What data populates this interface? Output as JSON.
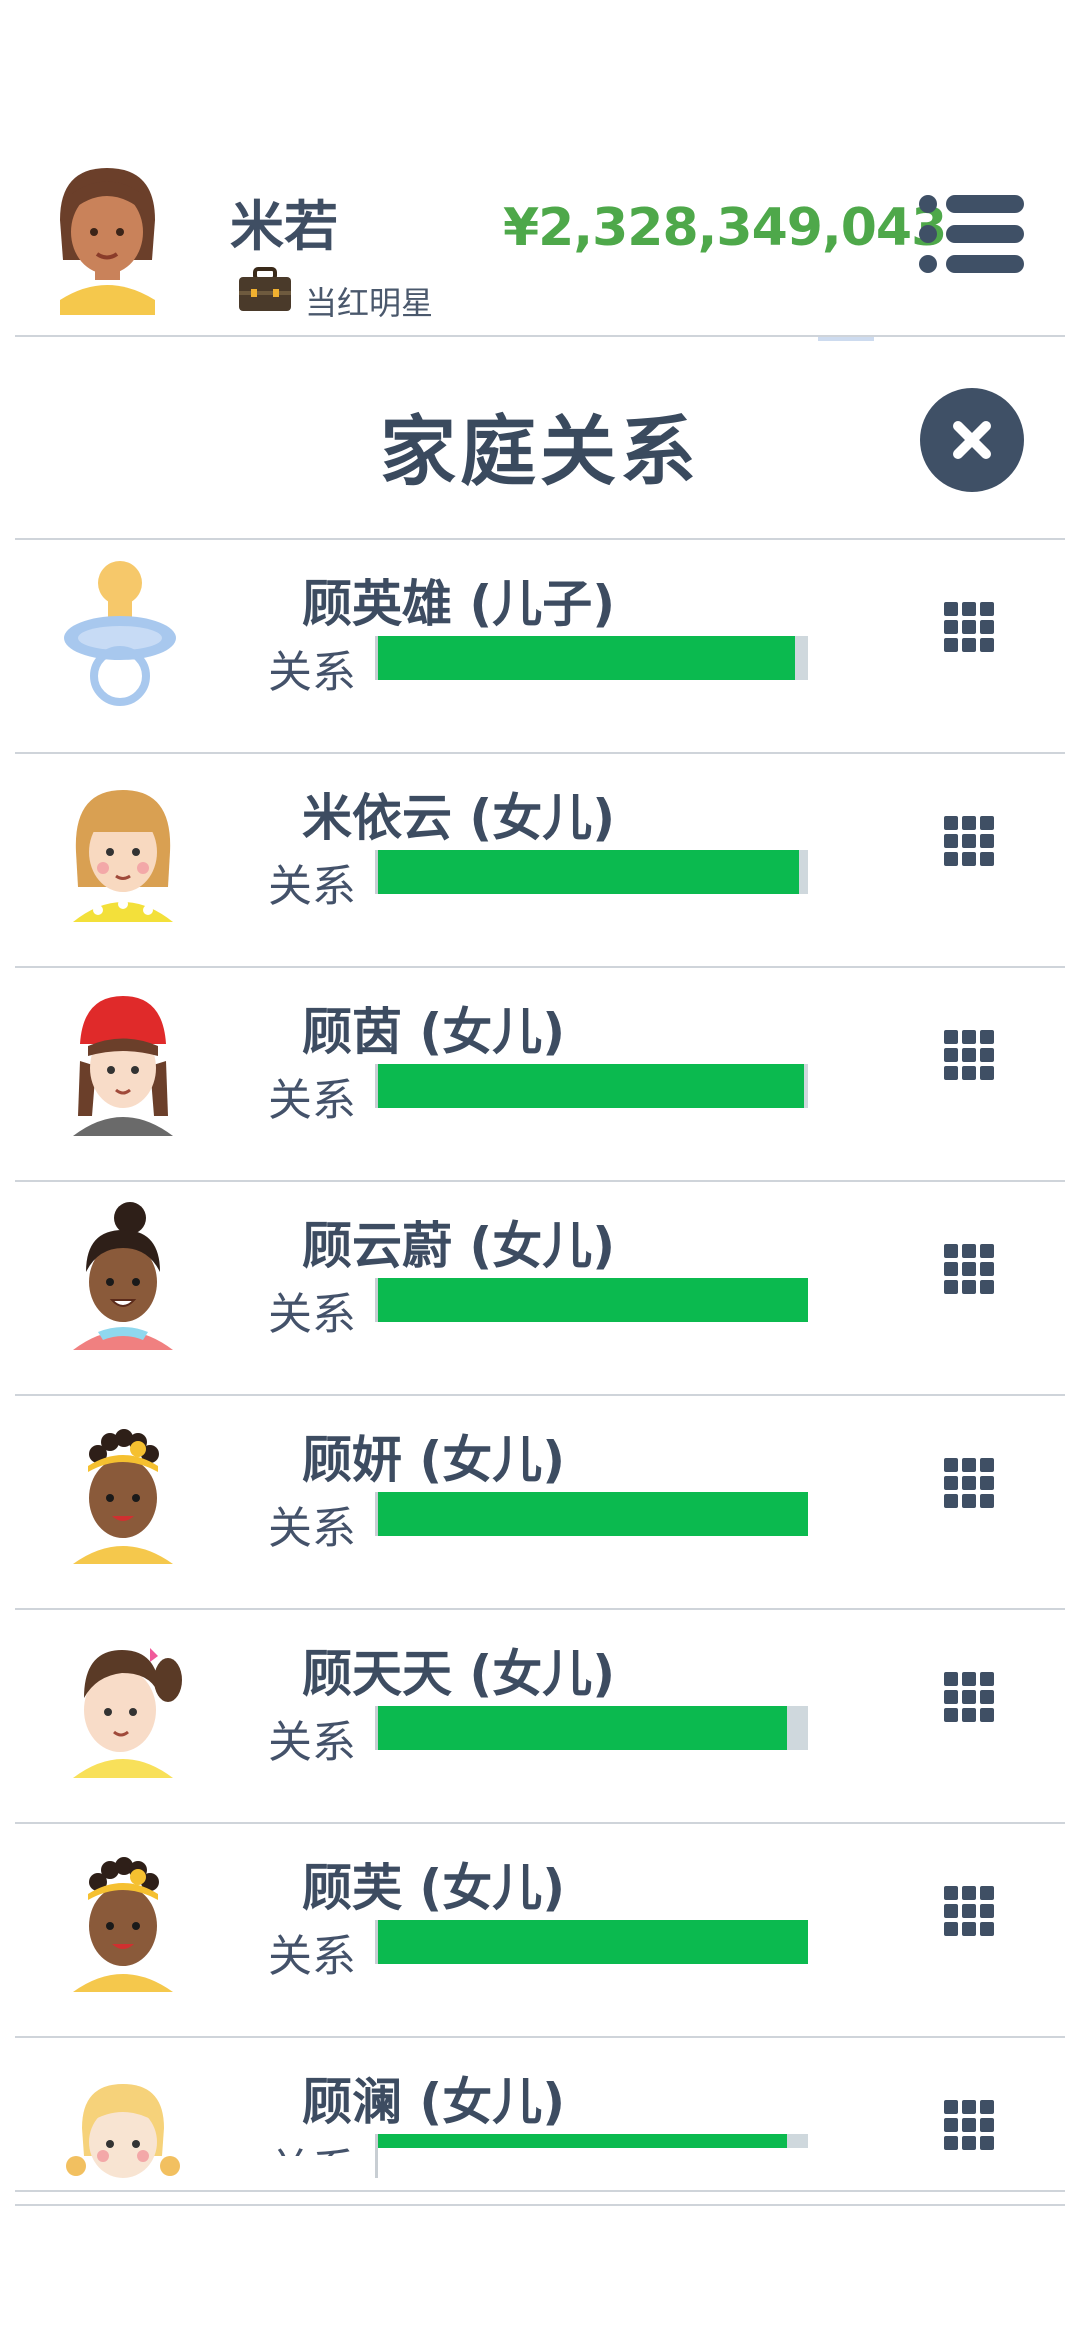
{
  "player": {
    "name": "米若",
    "job": "当红明星",
    "money": "¥2,328,349,043"
  },
  "panel": {
    "title": "家庭关系",
    "close_icon": "close-icon"
  },
  "colors": {
    "money": "#4ea84a",
    "bar_fill": "#0bba4f",
    "bar_track": "#cfd8dd",
    "text": "#3a4a5e"
  },
  "relation_label": "关系",
  "family": [
    {
      "name": "顾英雄 (儿子)",
      "avatar": "pacifier-icon",
      "relation": 0.97
    },
    {
      "name": "米依云 (女儿)",
      "avatar": "girl-blonde-avatar",
      "relation": 0.98
    },
    {
      "name": "顾茵 (女儿)",
      "avatar": "girl-red-hat-avatar",
      "relation": 0.99
    },
    {
      "name": "顾云蔚 (女儿)",
      "avatar": "girl-bun-avatar",
      "relation": 1.0
    },
    {
      "name": "顾妍 (女儿)",
      "avatar": "girl-headband-avatar",
      "relation": 1.0
    },
    {
      "name": "顾天天 (女儿)",
      "avatar": "girl-pigtails-avatar",
      "relation": 0.95
    },
    {
      "name": "顾芙 (女儿)",
      "avatar": "girl-headband-avatar",
      "relation": 1.0
    },
    {
      "name": "顾澜 (女儿)",
      "avatar": "girl-blonde-pigtails-avatar",
      "relation": 0.95
    }
  ]
}
